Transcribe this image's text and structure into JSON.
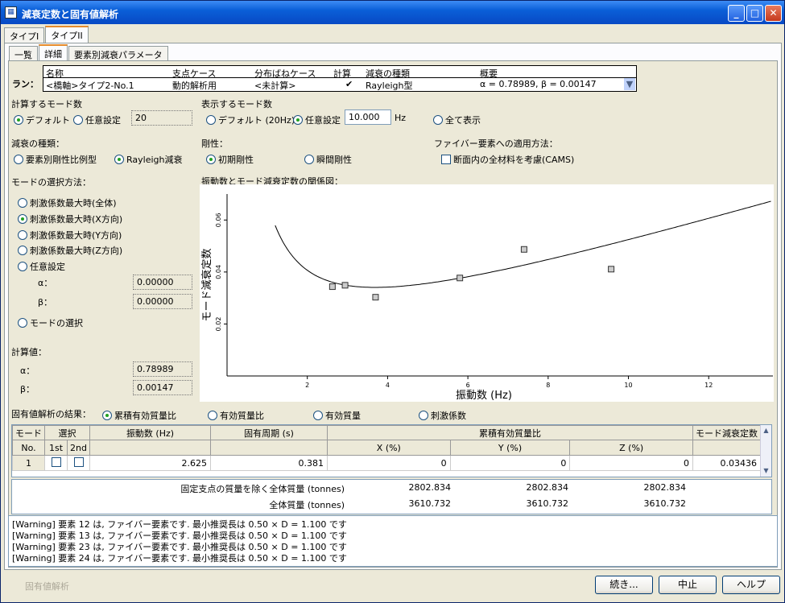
{
  "window": {
    "title": "減衰定数と固有値解析",
    "icon": "app-icon",
    "buttons": [
      "minimize-icon",
      "maximize-icon",
      "close-icon"
    ]
  },
  "type_tabs": [
    "タイプI",
    "タイプII"
  ],
  "sub_tabs": [
    "一覧",
    "詳細",
    "要素別減衰パラメータ"
  ],
  "run": {
    "label": "ラン：",
    "headers": [
      "名称",
      "支点ケース",
      "分布ばねケース",
      "計算",
      "減衰の種類",
      "概要"
    ],
    "values": [
      "<橋軸>タイプ2-No.1",
      "動的解析用",
      "<未計算>",
      "✔",
      "Rayleigh型",
      "α = 0.78989, β = 0.00147"
    ]
  },
  "calc_modes": {
    "title": "計算するモード数",
    "default": "デフォルト",
    "custom": "任意設定",
    "value": "20"
  },
  "display_modes": {
    "title": "表示するモード数",
    "default": "デフォルト (20Hz)",
    "custom": "任意設定",
    "value": "10.000",
    "unit": "Hz",
    "all": "全て表示"
  },
  "damping_type": {
    "title": "減衰の種類：",
    "opt1": "要素別剛性比例型",
    "opt2": "Rayleigh減衰"
  },
  "stiffness": {
    "title": "剛性：",
    "opt1": "初期剛性",
    "opt2": "瞬間剛性"
  },
  "fiber": {
    "title": "ファイバー要素への適用方法：",
    "opt": "断面内の全材料を考慮(CAMS)"
  },
  "mode_select": {
    "title": "モードの選択方法：",
    "opts": [
      "刺激係数最大時(全体)",
      "刺激係数最大時(X方向)",
      "刺激係数最大時(Y方向)",
      "刺激係数最大時(Z方向)",
      "任意設定"
    ],
    "alpha_label": "α：",
    "alpha": "0.00000",
    "beta_label": "β：",
    "beta": "0.00000",
    "mode_choice": "モードの選択"
  },
  "calc_values": {
    "title": "計算値：",
    "alpha_label": "α：",
    "alpha": "0.78989",
    "beta_label": "β：",
    "beta": "0.00147"
  },
  "chart_data": {
    "type": "scatter",
    "title": "振動数とモード減衰定数の関係図：",
    "xlabel": "振動数 (Hz)",
    "ylabel": "モード減衰定数",
    "xlim": [
      0,
      13.6
    ],
    "ylim": [
      0,
      0.07
    ],
    "xticks": [
      "2",
      "4",
      "6",
      "8",
      "10",
      "12"
    ],
    "yticks": [
      "0.02",
      "0.04",
      "0.06"
    ],
    "points": [
      [
        2.625,
        0.03436
      ],
      [
        2.94,
        0.0349
      ],
      [
        3.7,
        0.0303
      ],
      [
        5.8,
        0.0377
      ],
      [
        7.4,
        0.0487
      ],
      [
        9.57,
        0.0411
      ]
    ],
    "curve": {
      "alpha": 0.78989,
      "beta": 0.00147
    }
  },
  "result": {
    "title": "固有値解析の結果：",
    "opts": [
      "累積有効質量比",
      "有効質量比",
      "有効質量",
      "刺激係数"
    ],
    "headers": {
      "mode": "モード",
      "select": "選択",
      "freq": "振動数 (Hz)",
      "period": "固有周期 (s)",
      "cum": "累積有効質量比",
      "damp": "モード減衰定数",
      "no": "No.",
      "first": "1st",
      "second": "2nd",
      "x": "X (%)",
      "y": "Y (%)",
      "z": "Z (%)"
    },
    "row": {
      "no": "1",
      "freq": "2.625",
      "period": "0.381",
      "x": "0",
      "y": "0",
      "z": "0",
      "damp": "0.03436"
    }
  },
  "mass": {
    "row1_label": "固定支点の質量を除く全体質量 (tonnes)",
    "row1": [
      "2802.834",
      "2802.834",
      "2802.834"
    ],
    "row2_label": "全体質量 (tonnes)",
    "row2": [
      "3610.732",
      "3610.732",
      "3610.732"
    ]
  },
  "warnings": [
    "[Warning] 要素 12 は, ファイバー要素です. 最小推奨長は 0.50 × D = 1.100 です",
    "[Warning] 要素 13 は, ファイバー要素です. 最小推奨長は 0.50 × D = 1.100 です",
    "[Warning] 要素 23 は, ファイバー要素です. 最小推奨長は 0.50 × D = 1.100 です",
    "[Warning] 要素 24 は, ファイバー要素です. 最小推奨長は 0.50 × D = 1.100 です"
  ],
  "footer": {
    "disabled": "固有値解析",
    "continue": "続き...",
    "cancel": "中止",
    "help": "ヘルプ"
  }
}
